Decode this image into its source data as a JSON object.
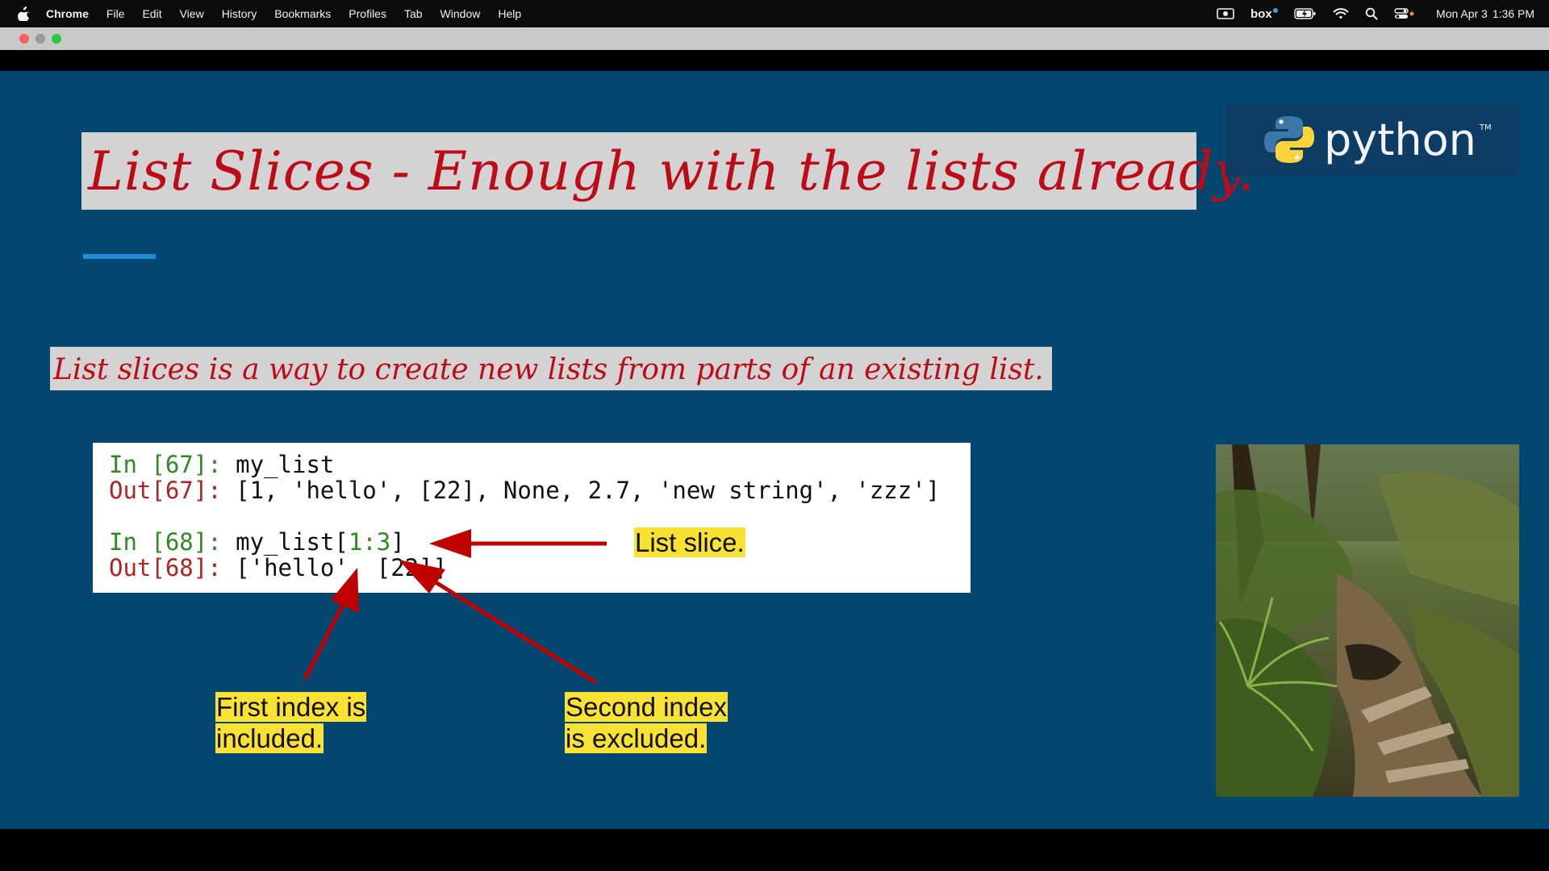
{
  "menubar": {
    "app_name": "Chrome",
    "items": [
      "File",
      "Edit",
      "View",
      "History",
      "Bookmarks",
      "Profiles",
      "Tab",
      "Window",
      "Help"
    ],
    "status_icons": [
      "screen-record-icon",
      "box-icon",
      "battery-icon",
      "wifi-icon",
      "search-icon",
      "control-center-icon"
    ],
    "date": "Mon Apr 3",
    "time": "1:36 PM"
  },
  "slide": {
    "title": "List Slices - Enough with the lists already.",
    "logo_text": "python",
    "logo_tm": "TM",
    "subtitle": "List slices is a way to create new lists from parts of an existing list.",
    "code": {
      "in67_prompt": "In [67]:",
      "in67_code": "my_list",
      "out67_prompt": "Out[67]:",
      "out67_value": "[1, 'hello', [22], None, 2.7, 'new string', 'zzz']",
      "in68_prompt": "In [68]:",
      "in68_code_prefix": "my_list[",
      "in68_code_slice": "1:3",
      "in68_code_suffix": "]",
      "out68_prompt": "Out[68]:",
      "out68_value": "['hello', [22]]"
    },
    "labels": {
      "list_slice": "List slice.",
      "first_index_line1": "First index is",
      "first_index_line2": "included.",
      "second_index_line1": "Second index",
      "second_index_line2": "is excluded."
    }
  },
  "colors": {
    "slide_background": "#034771",
    "title_text": "#bd0c17",
    "highlight": "#f9e234",
    "arrow": "#c00000"
  }
}
